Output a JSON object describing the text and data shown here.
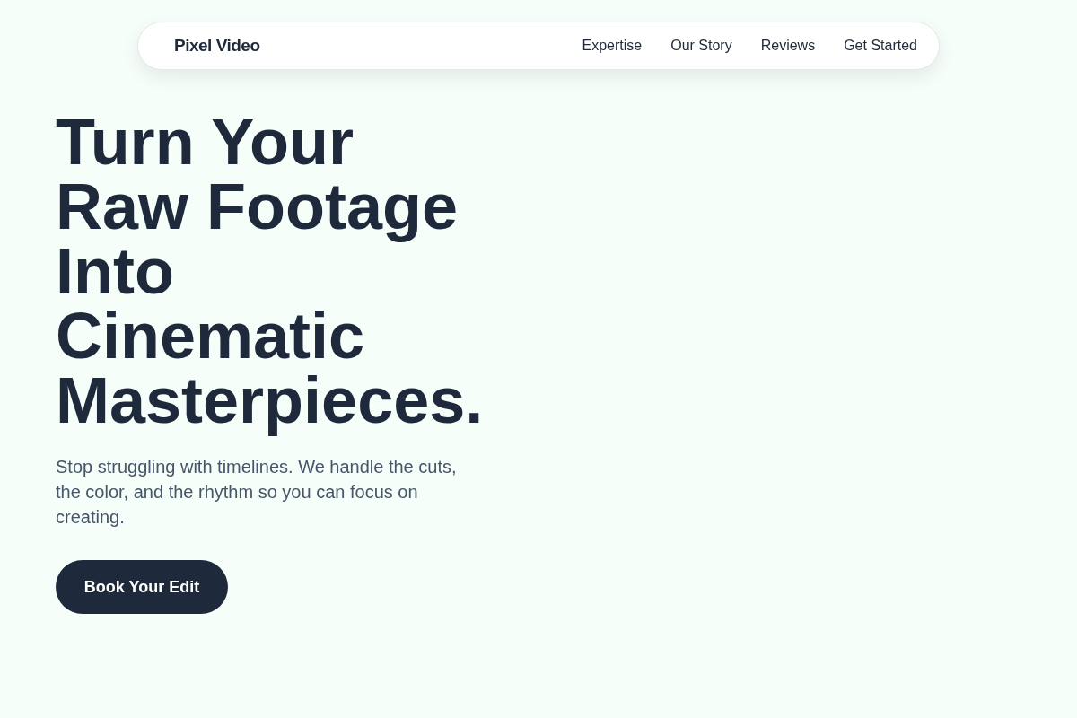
{
  "nav": {
    "logo": "Pixel Video",
    "links": [
      "Expertise",
      "Our Story",
      "Reviews",
      "Get Started"
    ]
  },
  "hero": {
    "title": "Turn Your Raw Footage Into Cinematic Masterpieces.",
    "subtitle": "Stop struggling with timelines. We handle the cuts, the color, and the rhythm so you can focus on creating.",
    "button": "Book Your Edit"
  }
}
